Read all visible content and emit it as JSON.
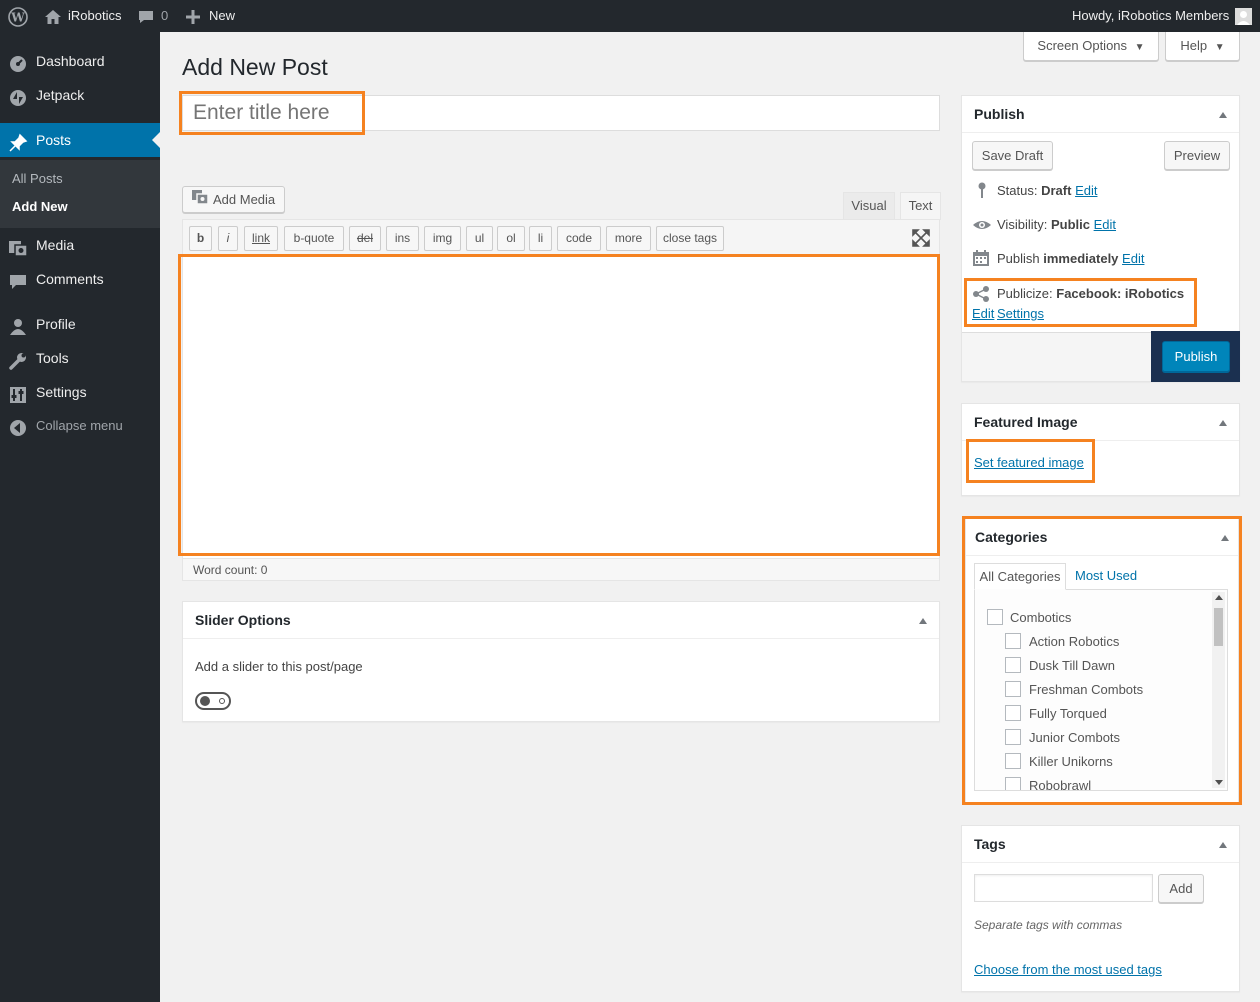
{
  "adminbar": {
    "site_name": "iRobotics",
    "comments_count": "0",
    "new_label": "New",
    "howdy": "Howdy, iRobotics Members"
  },
  "sidebar": {
    "items": [
      {
        "label": "Dashboard",
        "icon": "dashboard-icon"
      },
      {
        "label": "Jetpack",
        "icon": "jetpack-icon"
      },
      {
        "label": "Posts",
        "icon": "pin-icon"
      },
      {
        "label": "Media",
        "icon": "media-icon"
      },
      {
        "label": "Comments",
        "icon": "comment-icon"
      },
      {
        "label": "Profile",
        "icon": "user-icon"
      },
      {
        "label": "Tools",
        "icon": "wrench-icon"
      },
      {
        "label": "Settings",
        "icon": "settings-icon"
      },
      {
        "label": "Collapse menu",
        "icon": "collapse-icon"
      }
    ],
    "submenu": [
      "All Posts",
      "Add New"
    ]
  },
  "screen_options": "Screen Options",
  "help": "Help",
  "page_title": "Add New Post",
  "title_placeholder": "Enter title here",
  "editor": {
    "add_media": "Add Media",
    "tab_visual": "Visual",
    "tab_text": "Text",
    "quicktags": [
      "b",
      "i",
      "link",
      "b-quote",
      "del",
      "ins",
      "img",
      "ul",
      "ol",
      "li",
      "code",
      "more",
      "close tags"
    ],
    "word_count": "Word count: 0"
  },
  "slider": {
    "title": "Slider Options",
    "label": "Add a slider to this post/page"
  },
  "publish": {
    "title": "Publish",
    "save_draft": "Save Draft",
    "preview": "Preview",
    "status_label": "Status:",
    "status_value": "Draft",
    "visibility_label": "Visibility:",
    "visibility_value": "Public",
    "publish_label": "Publish",
    "publish_value": "immediately",
    "edit": "Edit",
    "publicize_label": "Publicize:",
    "publicize_value": "Facebook: iRobotics",
    "settings": "Settings",
    "publish_button": "Publish"
  },
  "featured": {
    "title": "Featured Image",
    "link": "Set featured image"
  },
  "categories": {
    "title": "Categories",
    "tab_all": "All Categories",
    "tab_most": "Most Used",
    "items": [
      {
        "label": "Combotics",
        "child": false
      },
      {
        "label": "Action Robotics",
        "child": true
      },
      {
        "label": "Dusk Till Dawn",
        "child": true
      },
      {
        "label": "Freshman Combots",
        "child": true
      },
      {
        "label": "Fully Torqued",
        "child": true
      },
      {
        "label": "Junior Combots",
        "child": true
      },
      {
        "label": "Killer Unikorns",
        "child": true
      },
      {
        "label": "Robobrawl",
        "child": true
      }
    ]
  },
  "tags": {
    "title": "Tags",
    "add": "Add",
    "hint": "Separate tags with commas",
    "choose": "Choose from the most used tags"
  },
  "colors": {
    "admin_bg": "#23282d",
    "accent": "#0073aa",
    "highlight": "#f58220"
  }
}
